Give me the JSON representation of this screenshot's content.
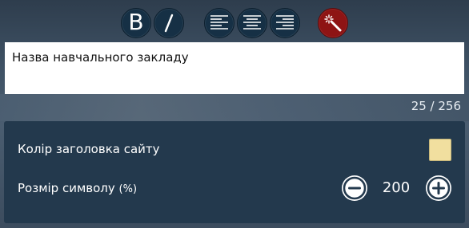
{
  "toolbar": {
    "bold_label": "B",
    "buttons": [
      "bold-icon",
      "italic-icon",
      "align-left-icon",
      "align-center-icon",
      "align-right-icon",
      "magic-wand-icon"
    ]
  },
  "editor": {
    "value": "Назва навчального закладу"
  },
  "counter": {
    "text": "25 / 256"
  },
  "settings": {
    "title_color_label": "Колір заголовка сайту",
    "title_color_value": "#f1df9f",
    "font_size_label": "Розмір символу",
    "font_size_unit": "(%)",
    "font_size_value": "200"
  },
  "colors": {
    "button_dark": "#163045",
    "button_magic": "#8e1414",
    "panel": "#23394d"
  }
}
